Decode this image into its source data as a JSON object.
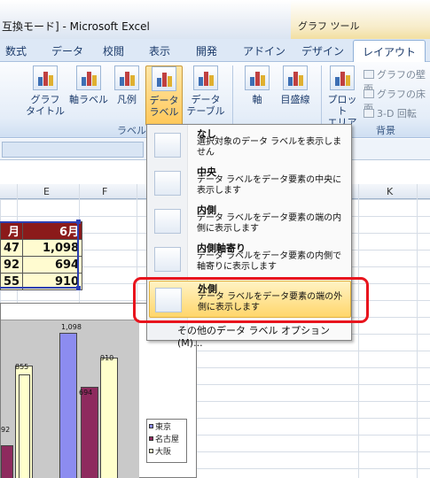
{
  "window": {
    "title": "互換モード] - Microsoft Excel",
    "context_title": "グラフ ツール"
  },
  "tabs": [
    "数式",
    "データ",
    "校閲",
    "表示",
    "開発",
    "アドイン",
    "デザイン",
    "レイアウト"
  ],
  "ribbon": {
    "buttons": {
      "chart_title": "グラフ\nタイトル",
      "axis_label": "軸ラベル",
      "legend": "凡例",
      "data_label": "データ\nラベル",
      "data_table": "データ\nテーブル",
      "axes": "軸",
      "gridlines": "目盛線",
      "plot_area": "プロット\nエリア"
    },
    "small_items": [
      "グラフの壁面",
      "グラフの床面",
      "3-D 回転"
    ],
    "group_labels": {
      "labels": "ラベル",
      "background": "背景"
    }
  },
  "columns": [
    "E",
    "F",
    "K"
  ],
  "table": {
    "headers": [
      "月",
      "6月"
    ],
    "rows": [
      [
        "47",
        "1,098"
      ],
      [
        "92",
        "694"
      ],
      [
        "55",
        "910"
      ]
    ]
  },
  "chart_data": {
    "type": "bar",
    "categories": [
      "",
      "",
      ""
    ],
    "series": [
      {
        "name": "東京",
        "values": [
          null,
          null,
          1098
        ]
      },
      {
        "name": "名古屋",
        "values": [
          null,
          null,
          694
        ]
      },
      {
        "name": "大阪",
        "values": [
          null,
          855,
          910
        ]
      }
    ],
    "data_labels": [
      "1,098",
      "855",
      "910",
      "694",
      "92"
    ],
    "legend_position": "right",
    "colors": {
      "東京": "#8c8cf0",
      "名古屋": "#8e2a5e",
      "大阪": "#ffffcc"
    }
  },
  "dropdown": {
    "items": [
      {
        "title": "なし",
        "desc": "選択対象のデータ ラベルを表示しません"
      },
      {
        "title": "中央",
        "desc": "データ ラベルをデータ要素の中央に表示します"
      },
      {
        "title": "内側",
        "desc": "データ ラベルをデータ要素の端の内側に表示します"
      },
      {
        "title": "内側軸寄り",
        "desc": "データ ラベルをデータ要素の内側で軸寄りに表示します"
      },
      {
        "title": "外側",
        "desc": "データ ラベルをデータ要素の端の外側に表示します"
      }
    ],
    "more": "その他のデータ ラベル オプション(M)..."
  }
}
